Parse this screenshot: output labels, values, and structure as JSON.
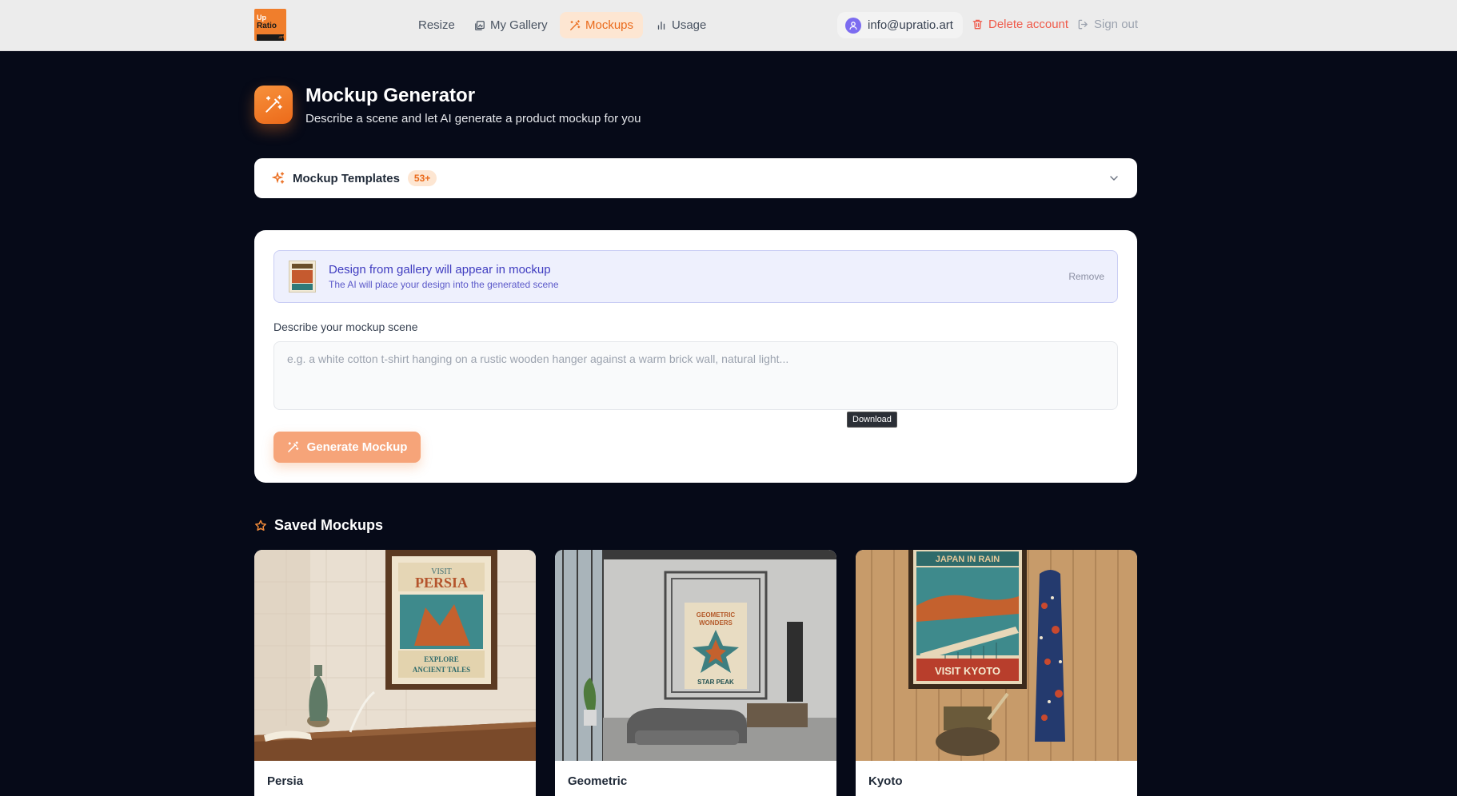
{
  "nav": {
    "logo": {
      "line1": "Up",
      "line2": "Ratio",
      "line3": ".art"
    },
    "items": [
      {
        "label": "Resize",
        "icon": "none"
      },
      {
        "label": "My Gallery",
        "icon": "gallery-icon"
      },
      {
        "label": "Mockups",
        "icon": "wand-icon",
        "active": true
      },
      {
        "label": "Usage",
        "icon": "bar-chart-icon"
      }
    ],
    "user_email": "info@upratio.art",
    "delete_label": "Delete account",
    "signout_label": "Sign out"
  },
  "header": {
    "title": "Mockup Generator",
    "subtitle": "Describe a scene and let AI generate a product mockup for you"
  },
  "templates": {
    "label": "Mockup Templates",
    "badge": "53+"
  },
  "design_banner": {
    "title": "Design from gallery will appear in mockup",
    "subtitle": "The AI will place your design into the generated scene",
    "remove_label": "Remove"
  },
  "scene": {
    "label": "Describe your mockup scene",
    "placeholder": "e.g. a white cotton t-shirt hanging on a rustic wooden hanger against a warm brick wall, natural light...",
    "value": ""
  },
  "tooltip": "Download",
  "generate_label": "Generate Mockup",
  "saved": {
    "heading": "Saved Mockups",
    "items": [
      {
        "name": "Persia"
      },
      {
        "name": "Geometric"
      },
      {
        "name": "Kyoto"
      }
    ]
  },
  "colors": {
    "accent": "#ea6a1b",
    "background": "#060a18",
    "banner": "#eef0fd"
  }
}
